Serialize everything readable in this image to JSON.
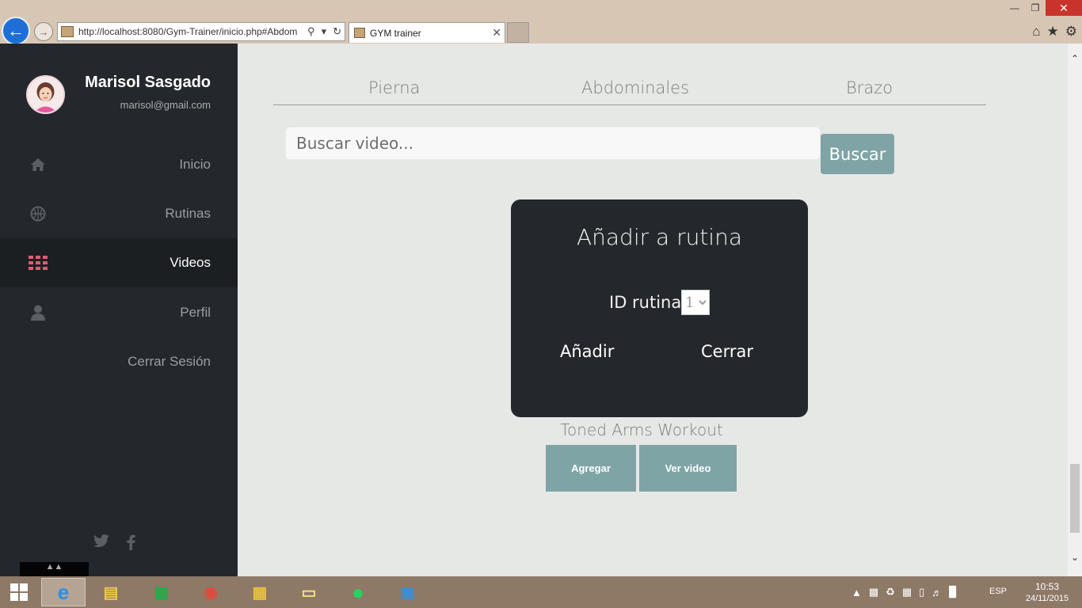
{
  "browser": {
    "url": "http://localhost:8080/Gym-Trainer/inicio.php#Abdom",
    "tab_title": "GYM trainer"
  },
  "sidebar": {
    "user_name": "Marisol Sasgado",
    "user_email": "marisol@gmail.com",
    "items": [
      {
        "label": "Inicio",
        "icon": "home-icon"
      },
      {
        "label": "Rutinas",
        "icon": "basketball-icon"
      },
      {
        "label": "Videos",
        "icon": "grid-icon"
      },
      {
        "label": "Perfil",
        "icon": "user-icon"
      },
      {
        "label": "Cerrar Sesión",
        "icon": ""
      }
    ]
  },
  "content": {
    "categories": [
      "Pierna",
      "Abdominales",
      "Brazo"
    ],
    "search_placeholder": "Buscar video...",
    "search_button": "Buscar",
    "modal": {
      "title": "Añadir a rutina",
      "id_label": "ID rutina",
      "id_selected": "1",
      "add_label": "Añadir",
      "close_label": "Cerrar"
    },
    "video_title": "Toned Arms Workout",
    "add_button": "Agregar",
    "view_button": "Ver video"
  },
  "taskbar": {
    "language": "ESP",
    "time": "10:53",
    "date": "24/11/2015"
  },
  "colors": {
    "sidebar_bg": "#24282c",
    "accent_active": "#e35a74",
    "button_teal": "#7fa4a6"
  }
}
